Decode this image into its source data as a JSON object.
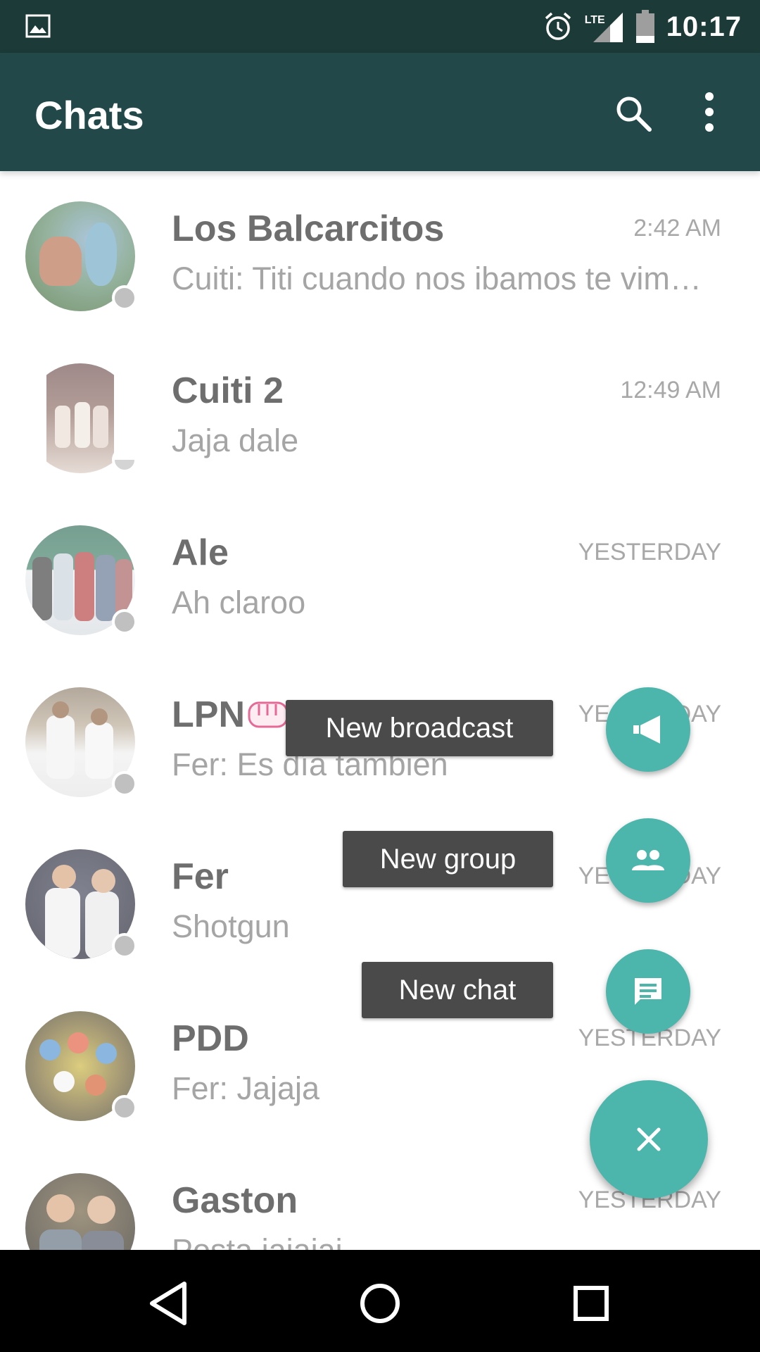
{
  "status_bar": {
    "time": "10:17",
    "network_label": "LTE",
    "icons": [
      "image-notification-icon",
      "alarm-icon",
      "signal-icon",
      "battery-icon"
    ]
  },
  "app_bar": {
    "title": "Chats",
    "icons": [
      "search-icon",
      "more-vert-icon"
    ]
  },
  "chats": [
    {
      "name": "Los Balcarcitos",
      "time": "2:42 AM",
      "preview": "Cuiti: Titi cuando nos ibamos te vimos con el señor y el auto"
    },
    {
      "name": "Cuiti 2",
      "time": "12:49 AM",
      "preview": "Jaja dale"
    },
    {
      "name": "Ale",
      "time": "YESTERDAY",
      "preview": "Ah claroo"
    },
    {
      "name": "LPN",
      "time": "YESTERDAY",
      "preview": "Fer: Es día tambien"
    },
    {
      "name": "Fer",
      "time": "YESTERDAY",
      "preview": "Shotgun"
    },
    {
      "name": "PDD",
      "time": "YESTERDAY",
      "preview": "Fer: Jajaja"
    },
    {
      "name": "Gaston",
      "time": "YESTERDAY",
      "preview": "Posta jajajaj"
    }
  ],
  "fab_menu": {
    "broadcast_label": "New broadcast",
    "group_label": "New group",
    "chat_label": "New chat",
    "close_icon": "close-icon"
  },
  "colors": {
    "status_bar": "#1c3a37",
    "app_bar": "#22484a",
    "fab": "#4db6ac",
    "label_bg": "#4a4a4a"
  },
  "nav_bar": {
    "icons": [
      "back-icon",
      "home-icon",
      "recents-icon"
    ]
  }
}
